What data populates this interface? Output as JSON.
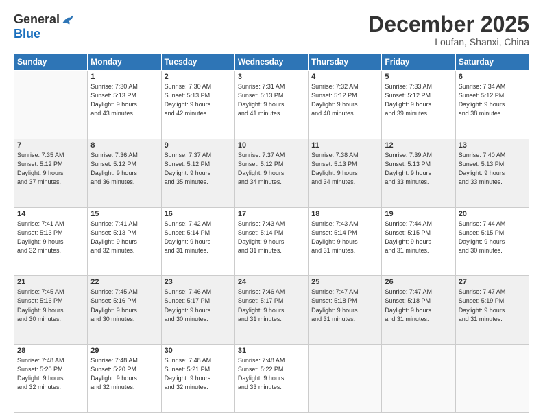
{
  "logo": {
    "general": "General",
    "blue": "Blue"
  },
  "header": {
    "month": "December 2025",
    "location": "Loufan, Shanxi, China"
  },
  "days_of_week": [
    "Sunday",
    "Monday",
    "Tuesday",
    "Wednesday",
    "Thursday",
    "Friday",
    "Saturday"
  ],
  "weeks": [
    [
      {
        "day": "",
        "info": ""
      },
      {
        "day": "1",
        "info": "Sunrise: 7:30 AM\nSunset: 5:13 PM\nDaylight: 9 hours\nand 43 minutes."
      },
      {
        "day": "2",
        "info": "Sunrise: 7:30 AM\nSunset: 5:13 PM\nDaylight: 9 hours\nand 42 minutes."
      },
      {
        "day": "3",
        "info": "Sunrise: 7:31 AM\nSunset: 5:13 PM\nDaylight: 9 hours\nand 41 minutes."
      },
      {
        "day": "4",
        "info": "Sunrise: 7:32 AM\nSunset: 5:12 PM\nDaylight: 9 hours\nand 40 minutes."
      },
      {
        "day": "5",
        "info": "Sunrise: 7:33 AM\nSunset: 5:12 PM\nDaylight: 9 hours\nand 39 minutes."
      },
      {
        "day": "6",
        "info": "Sunrise: 7:34 AM\nSunset: 5:12 PM\nDaylight: 9 hours\nand 38 minutes."
      }
    ],
    [
      {
        "day": "7",
        "info": "Sunrise: 7:35 AM\nSunset: 5:12 PM\nDaylight: 9 hours\nand 37 minutes."
      },
      {
        "day": "8",
        "info": "Sunrise: 7:36 AM\nSunset: 5:12 PM\nDaylight: 9 hours\nand 36 minutes."
      },
      {
        "day": "9",
        "info": "Sunrise: 7:37 AM\nSunset: 5:12 PM\nDaylight: 9 hours\nand 35 minutes."
      },
      {
        "day": "10",
        "info": "Sunrise: 7:37 AM\nSunset: 5:12 PM\nDaylight: 9 hours\nand 34 minutes."
      },
      {
        "day": "11",
        "info": "Sunrise: 7:38 AM\nSunset: 5:13 PM\nDaylight: 9 hours\nand 34 minutes."
      },
      {
        "day": "12",
        "info": "Sunrise: 7:39 AM\nSunset: 5:13 PM\nDaylight: 9 hours\nand 33 minutes."
      },
      {
        "day": "13",
        "info": "Sunrise: 7:40 AM\nSunset: 5:13 PM\nDaylight: 9 hours\nand 33 minutes."
      }
    ],
    [
      {
        "day": "14",
        "info": "Sunrise: 7:41 AM\nSunset: 5:13 PM\nDaylight: 9 hours\nand 32 minutes."
      },
      {
        "day": "15",
        "info": "Sunrise: 7:41 AM\nSunset: 5:13 PM\nDaylight: 9 hours\nand 32 minutes."
      },
      {
        "day": "16",
        "info": "Sunrise: 7:42 AM\nSunset: 5:14 PM\nDaylight: 9 hours\nand 31 minutes."
      },
      {
        "day": "17",
        "info": "Sunrise: 7:43 AM\nSunset: 5:14 PM\nDaylight: 9 hours\nand 31 minutes."
      },
      {
        "day": "18",
        "info": "Sunrise: 7:43 AM\nSunset: 5:14 PM\nDaylight: 9 hours\nand 31 minutes."
      },
      {
        "day": "19",
        "info": "Sunrise: 7:44 AM\nSunset: 5:15 PM\nDaylight: 9 hours\nand 31 minutes."
      },
      {
        "day": "20",
        "info": "Sunrise: 7:44 AM\nSunset: 5:15 PM\nDaylight: 9 hours\nand 30 minutes."
      }
    ],
    [
      {
        "day": "21",
        "info": "Sunrise: 7:45 AM\nSunset: 5:16 PM\nDaylight: 9 hours\nand 30 minutes."
      },
      {
        "day": "22",
        "info": "Sunrise: 7:45 AM\nSunset: 5:16 PM\nDaylight: 9 hours\nand 30 minutes."
      },
      {
        "day": "23",
        "info": "Sunrise: 7:46 AM\nSunset: 5:17 PM\nDaylight: 9 hours\nand 30 minutes."
      },
      {
        "day": "24",
        "info": "Sunrise: 7:46 AM\nSunset: 5:17 PM\nDaylight: 9 hours\nand 31 minutes."
      },
      {
        "day": "25",
        "info": "Sunrise: 7:47 AM\nSunset: 5:18 PM\nDaylight: 9 hours\nand 31 minutes."
      },
      {
        "day": "26",
        "info": "Sunrise: 7:47 AM\nSunset: 5:18 PM\nDaylight: 9 hours\nand 31 minutes."
      },
      {
        "day": "27",
        "info": "Sunrise: 7:47 AM\nSunset: 5:19 PM\nDaylight: 9 hours\nand 31 minutes."
      }
    ],
    [
      {
        "day": "28",
        "info": "Sunrise: 7:48 AM\nSunset: 5:20 PM\nDaylight: 9 hours\nand 32 minutes."
      },
      {
        "day": "29",
        "info": "Sunrise: 7:48 AM\nSunset: 5:20 PM\nDaylight: 9 hours\nand 32 minutes."
      },
      {
        "day": "30",
        "info": "Sunrise: 7:48 AM\nSunset: 5:21 PM\nDaylight: 9 hours\nand 32 minutes."
      },
      {
        "day": "31",
        "info": "Sunrise: 7:48 AM\nSunset: 5:22 PM\nDaylight: 9 hours\nand 33 minutes."
      },
      {
        "day": "",
        "info": ""
      },
      {
        "day": "",
        "info": ""
      },
      {
        "day": "",
        "info": ""
      }
    ]
  ]
}
